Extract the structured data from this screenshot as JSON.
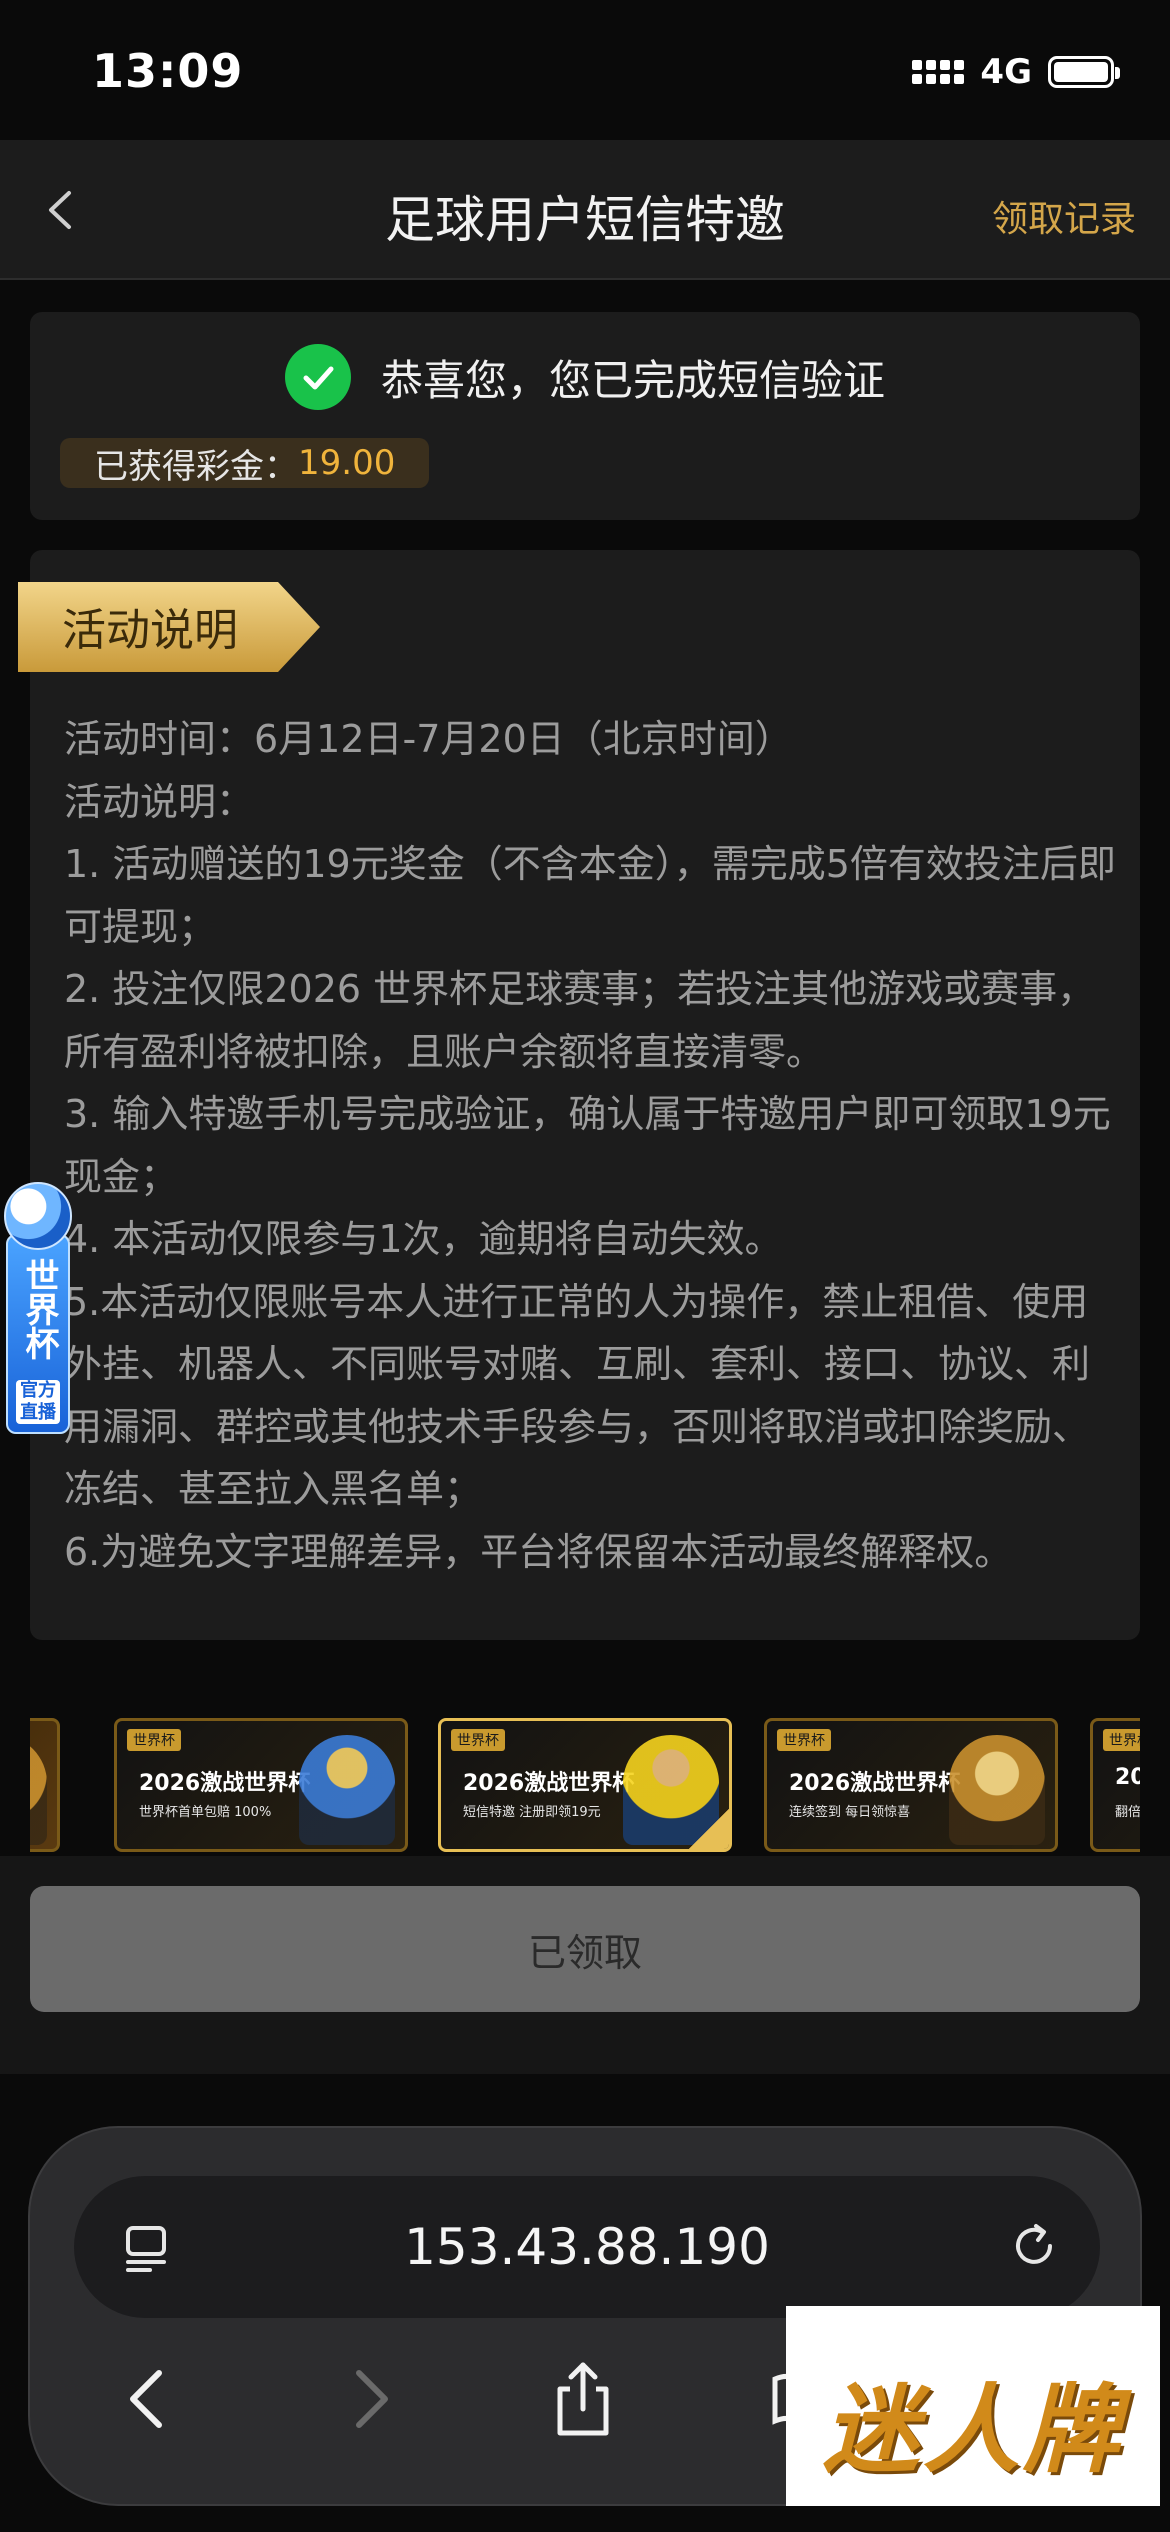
{
  "status_bar": {
    "time": "13:09",
    "network": "4G"
  },
  "nav": {
    "title": "足球用户短信特邀",
    "record_link": "领取记录"
  },
  "success": {
    "message": "恭喜您，您已完成短信验证",
    "bonus_label": "已获得彩金：",
    "bonus_value": "19.00"
  },
  "activity": {
    "ribbon_title": "活动说明",
    "lines": [
      "活动时间：6月12日-7月20日（北京时间）",
      "活动说明：",
      "1. 活动赠送的19元奖金（不含本金），需完成5倍有效投注后即可提现；",
      "2. 投注仅限2026 世界杯足球赛事；若投注其他游戏或赛事，所有盈利将被扣除，且账户余额将直接清零。",
      "3. 输入特邀手机号完成验证，确认属于特邀用户即可领取19元现金；",
      "4. 本活动仅限参与1次，逾期将自动失效。",
      "5.本活动仅限账号本人进行正常的人为操作，禁止租借、使用外挂、机器人、不同账号对赌、互刷、套利、接口、协议、利用漏洞、群控或其他技术手段参与，否则将取消或扣除奖励、冻结、甚至拉入黑名单；",
      "6.为避免文字理解差异，平台将保留本活动最终解释权。"
    ]
  },
  "floating_badge": {
    "title": "世界杯",
    "subtitle": "官方直播"
  },
  "banners": [
    {
      "tag": "世界杯",
      "title": "2026激战世界杯",
      "subtitle": "世界杯首单包赔 100%"
    },
    {
      "tag": "世界杯",
      "title": "2026激战世界杯",
      "subtitle": "短信特邀 注册即领19元"
    },
    {
      "tag": "世界杯",
      "title": "2026激战世界杯",
      "subtitle": "连续签到 每日领惊喜"
    },
    {
      "tag": "世界杯",
      "title": "20",
      "subtitle": "翻倍"
    }
  ],
  "claim_button": {
    "label": "已领取"
  },
  "browser": {
    "url": "153.43.88.190"
  },
  "watermark": {
    "text": "迷人牌"
  },
  "colors": {
    "accent_gold": "#d4a64a",
    "bonus_value": "#f0b43c",
    "success_green": "#19c24a",
    "card_bg": "#1c1c1c",
    "claimed_button": "#6b6b6b"
  }
}
